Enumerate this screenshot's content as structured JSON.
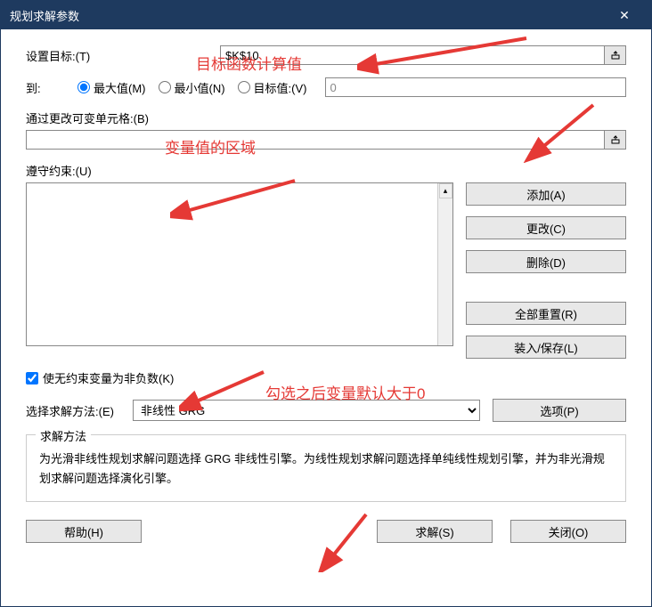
{
  "titlebar": {
    "title": "规划求解参数"
  },
  "objective": {
    "label": "设置目标:(T)",
    "value": "$K$10",
    "annotation": "目标函数计算值"
  },
  "to": {
    "label": "到:",
    "max": "最大值(M)",
    "min": "最小值(N)",
    "valueOf": "目标值:(V)",
    "targetValue": "0"
  },
  "changing": {
    "label": "通过更改可变单元格:(B)",
    "value": "",
    "annotation": "变量值的区域"
  },
  "constraints": {
    "label": "遵守约束:(U)"
  },
  "sideButtons": {
    "add": "添加(A)",
    "change": "更改(C)",
    "delete": "删除(D)",
    "resetAll": "全部重置(R)",
    "loadSave": "装入/保存(L)"
  },
  "nonneg": {
    "label": "使无约束变量为非负数(K)",
    "annotation": "勾选之后变量默认大于0"
  },
  "method": {
    "label": "选择求解方法:(E)",
    "selected": "非线性 GRG",
    "optionsBtn": "选项(P)"
  },
  "groupbox": {
    "title": "求解方法",
    "text": "为光滑非线性规划求解问题选择 GRG 非线性引擎。为线性规划求解问题选择单纯线性规划引擎，并为非光滑规划求解问题选择演化引擎。"
  },
  "footer": {
    "help": "帮助(H)",
    "solve": "求解(S)",
    "close": "关闭(O)"
  }
}
